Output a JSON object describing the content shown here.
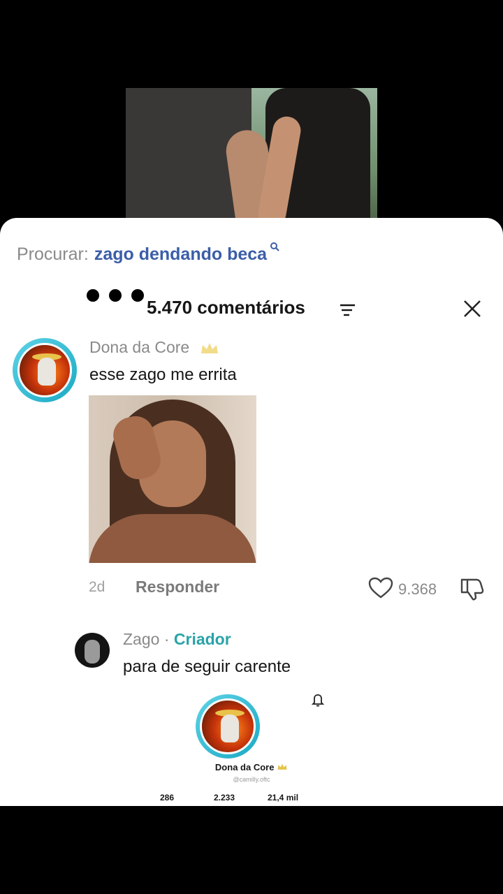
{
  "search": {
    "label": "Procurar:",
    "query": "zago dendando beca"
  },
  "comments": {
    "count_label": "5.470 comentários"
  },
  "comment": {
    "username": "Dona da Core",
    "text": "esse zago me errita",
    "time": "2d",
    "reply_label": "Responder",
    "likes": "9.368"
  },
  "reply": {
    "username": "Zago",
    "separator": "·",
    "role": "Criador",
    "text": "para de seguir carente"
  },
  "profile_card": {
    "name": "Dona da Core",
    "handle": "@camilly.oftc",
    "stats": [
      "286",
      "2.233",
      "21,4 mil"
    ]
  },
  "colors": {
    "link_blue": "#3b5ea8",
    "creator_teal": "#2aa3a8",
    "avatar_ring": "#1ba9c4"
  }
}
